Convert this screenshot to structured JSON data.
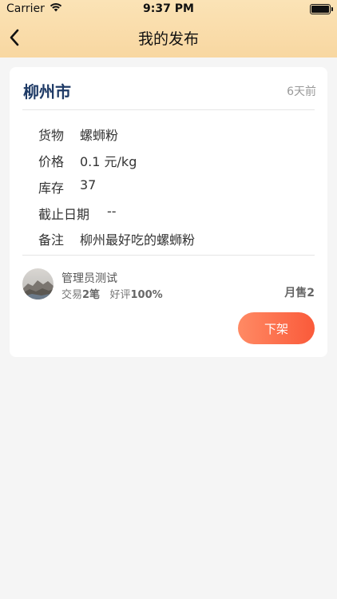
{
  "status_bar": {
    "carrier": "Carrier",
    "time": "9:37 PM"
  },
  "nav": {
    "title": "我的发布"
  },
  "listing": {
    "city": "柳州市",
    "posted_ago": "6天前",
    "details": [
      {
        "label": "货物",
        "value": "螺蛳粉"
      },
      {
        "label": "价格",
        "value": "0.1 元/kg"
      },
      {
        "label": "库存",
        "value": "37"
      },
      {
        "label": "截止日期",
        "value": "--"
      },
      {
        "label": "备注",
        "value": "柳州最好吃的螺蛳粉"
      }
    ],
    "seller": {
      "name": "管理员测试",
      "trade_prefix": "交易",
      "trade_count": "2笔",
      "rating_prefix": "好评",
      "rating": "100%",
      "monthly_sales": "月售2"
    },
    "action_label": "下架"
  }
}
